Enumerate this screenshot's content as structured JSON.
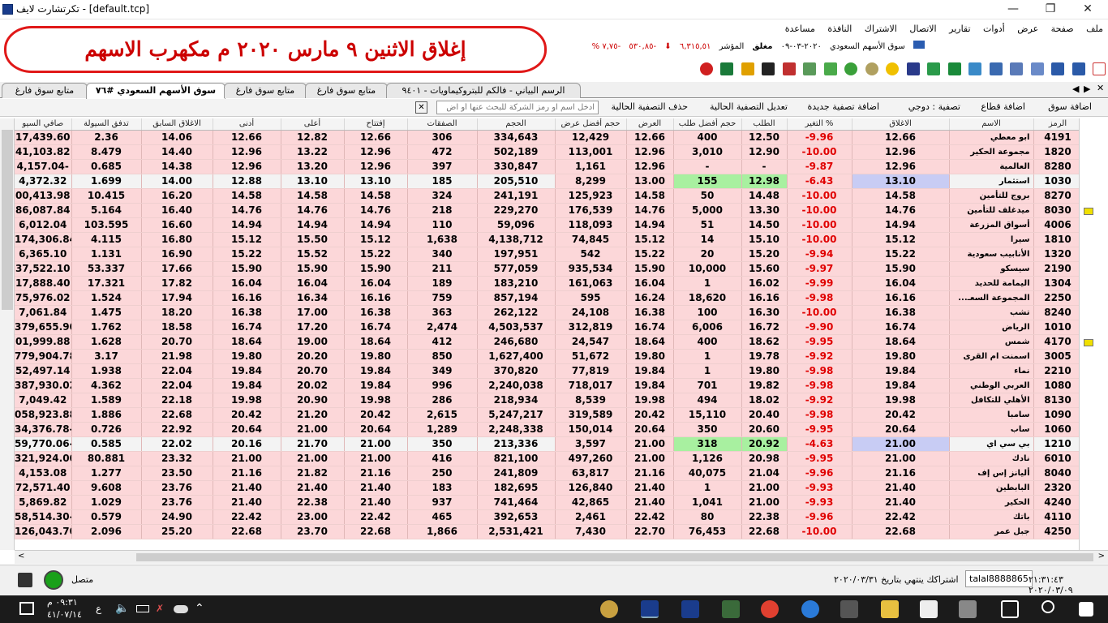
{
  "window": {
    "title": "تكرتشارت لايف - [default.tcp]"
  },
  "menu": [
    "ملف",
    "صفحة",
    "عرض",
    "أدوات",
    "تقارير",
    "الاتصال",
    "الاشتراك",
    "النافذة",
    "مساعدة"
  ],
  "banner": {
    "text": "إغلاق الاثنين ٩ مارس ٢٠٢٠ م  مكهرب الاسهم"
  },
  "ticker": {
    "market": "سوق الأسهم السعودي",
    "date": "٢٠٢٠-٠٣-٠٩",
    "state": "مغلق",
    "index_label": "المؤشر",
    "index_value": "٦,٣١٥,٥١",
    "change": "-٥٣٠,٨٥",
    "pct": "-٧,٧٥ %"
  },
  "tabs": [
    "متابع سوق فارغ",
    "سوق الأسهم السعودي #٧٦",
    "متابع سوق فارغ",
    "متابع سوق فارغ",
    "الرسم البياني - فالكم للبتروكيماويات - ٩٤٠١"
  ],
  "filterbar": {
    "add_market": "اضافة سوق",
    "add_sector": "اضافة قطاع",
    "filter": "تصفية : دوجي",
    "new_filter": "اضافة تصفية جديدة",
    "edit_filter": "تعديل التصفية الحالية",
    "delete_filter": "حذف التصفية الحالية",
    "search_placeholder": "ادخل اسم او رمز الشركة للبحث عنها أو اض"
  },
  "columns": [
    "صافي السيو",
    "تدفق السيولة",
    "الاغلاق السابق",
    "أدنى",
    "أعلى",
    "إفتتاح",
    "الصفقات",
    "الحجم",
    "حجم أفضل عرض",
    "العرض",
    "حجم أفضل طلب",
    "الطلب",
    "التغير %",
    "الاغلاق",
    "الاسم",
    "الرمز"
  ],
  "rows": [
    {
      "code": "4191",
      "name": "ابو معطي",
      "close": "12.66",
      "pct": "-9.96",
      "bid": "12.50",
      "bidsize": "400",
      "ask": "12.66",
      "asksize": "12,429",
      "vol": "334,643",
      "trades": "306",
      "open": "12.66",
      "high": "12.82",
      "low": "12.66",
      "prev": "14.06",
      "flow": "2.36",
      "net": "17,439.60"
    },
    {
      "code": "1820",
      "name": "مجموعة الحكير",
      "close": "12.96",
      "pct": "-10.00",
      "bid": "12.90",
      "bidsize": "3,010",
      "ask": "12.96",
      "asksize": "113,001",
      "vol": "502,189",
      "trades": "472",
      "open": "12.96",
      "high": "13.22",
      "low": "12.96",
      "prev": "14.40",
      "flow": "8.479",
      "net": "41,103.82"
    },
    {
      "code": "8280",
      "name": "العالمية",
      "close": "12.96",
      "pct": "-9.87",
      "bid": "-",
      "bidsize": "-",
      "ask": "12.96",
      "asksize": "1,161",
      "vol": "330,847",
      "trades": "397",
      "open": "12.96",
      "high": "13.20",
      "low": "12.96",
      "prev": "14.38",
      "flow": "0.685",
      "net": "4,157.04-"
    },
    {
      "code": "1030",
      "name": "استثمار",
      "close": "13.10",
      "pct": "-6.43",
      "bid": "12.98",
      "bidsize": "155",
      "ask": "13.00",
      "asksize": "8,299",
      "vol": "205,510",
      "trades": "185",
      "open": "13.10",
      "high": "13.10",
      "low": "12.88",
      "prev": "14.00",
      "flow": "1.699",
      "net": "4,372.32",
      "hl": true
    },
    {
      "code": "8270",
      "name": "بروج للتأمين",
      "close": "14.58",
      "pct": "-10.00",
      "bid": "14.48",
      "bidsize": "50",
      "ask": "14.58",
      "asksize": "125,923",
      "vol": "241,191",
      "trades": "324",
      "open": "14.58",
      "high": "14.58",
      "low": "14.58",
      "prev": "16.20",
      "flow": "10.415",
      "net": "00,413.98"
    },
    {
      "code": "8030",
      "name": "ميدغلف للتأمين",
      "close": "14.76",
      "pct": "-10.00",
      "bid": "13.30",
      "bidsize": "5,000",
      "ask": "14.76",
      "asksize": "176,539",
      "vol": "229,270",
      "trades": "218",
      "open": "14.76",
      "high": "14.76",
      "low": "14.76",
      "prev": "16.40",
      "flow": "5.164",
      "net": "86,087.84",
      "flag": true
    },
    {
      "code": "4006",
      "name": "أسواق المزرعة",
      "close": "14.94",
      "pct": "-10.00",
      "bid": "14.50",
      "bidsize": "51",
      "ask": "14.94",
      "asksize": "118,093",
      "vol": "59,096",
      "trades": "110",
      "open": "14.94",
      "high": "14.94",
      "low": "14.94",
      "prev": "16.60",
      "flow": "103.595",
      "net": "6,012.04"
    },
    {
      "code": "1810",
      "name": "سيرا",
      "close": "15.12",
      "pct": "-10.00",
      "bid": "15.10",
      "bidsize": "14",
      "ask": "15.12",
      "asksize": "74,845",
      "vol": "4,138,712",
      "trades": "1,638",
      "open": "15.12",
      "high": "15.50",
      "low": "15.12",
      "prev": "16.80",
      "flow": "4.115",
      "net": "174,306.84"
    },
    {
      "code": "1320",
      "name": "الأنابيب سعودية",
      "close": "15.22",
      "pct": "-9.94",
      "bid": "15.20",
      "bidsize": "20",
      "ask": "15.22",
      "asksize": "542",
      "vol": "197,951",
      "trades": "340",
      "open": "15.22",
      "high": "15.52",
      "low": "15.22",
      "prev": "16.90",
      "flow": "1.131",
      "net": "6,365.10"
    },
    {
      "code": "2190",
      "name": "سيسكو",
      "close": "15.90",
      "pct": "-9.97",
      "bid": "15.60",
      "bidsize": "10,000",
      "ask": "15.90",
      "asksize": "935,534",
      "vol": "577,059",
      "trades": "211",
      "open": "15.90",
      "high": "15.90",
      "low": "15.90",
      "prev": "17.66",
      "flow": "53.337",
      "net": "37,522.10"
    },
    {
      "code": "1304",
      "name": "اليمامة للحديد",
      "close": "16.04",
      "pct": "-9.99",
      "bid": "16.02",
      "bidsize": "1",
      "ask": "16.04",
      "asksize": "161,063",
      "vol": "183,210",
      "trades": "189",
      "open": "16.04",
      "high": "16.04",
      "low": "16.04",
      "prev": "17.82",
      "flow": "17.321",
      "net": "17,888.40"
    },
    {
      "code": "2250",
      "name": "المجموعة السعـ...",
      "close": "16.16",
      "pct": "-9.98",
      "bid": "16.16",
      "bidsize": "18,620",
      "ask": "16.24",
      "asksize": "595",
      "vol": "857,194",
      "trades": "759",
      "open": "16.16",
      "high": "16.34",
      "low": "16.16",
      "prev": "17.94",
      "flow": "1.524",
      "net": "75,976.02"
    },
    {
      "code": "8240",
      "name": "تشب",
      "close": "16.38",
      "pct": "-10.00",
      "bid": "16.30",
      "bidsize": "100",
      "ask": "16.38",
      "asksize": "24,108",
      "vol": "262,122",
      "trades": "363",
      "open": "16.38",
      "high": "17.00",
      "low": "16.38",
      "prev": "18.20",
      "flow": "1.475",
      "net": "7,061.84"
    },
    {
      "code": "1010",
      "name": "الرياض",
      "close": "16.74",
      "pct": "-9.90",
      "bid": "16.72",
      "bidsize": "6,006",
      "ask": "16.74",
      "asksize": "312,819",
      "vol": "4,503,537",
      "trades": "2,474",
      "open": "16.74",
      "high": "17.20",
      "low": "16.74",
      "prev": "18.58",
      "flow": "1.762",
      "net": "379,655.90"
    },
    {
      "code": "4170",
      "name": "شمس",
      "close": "18.64",
      "pct": "-9.95",
      "bid": "18.62",
      "bidsize": "400",
      "ask": "18.64",
      "asksize": "24,547",
      "vol": "246,680",
      "trades": "412",
      "open": "18.64",
      "high": "19.00",
      "low": "18.64",
      "prev": "20.70",
      "flow": "1.628",
      "net": "01,999.88",
      "flag": true
    },
    {
      "code": "3005",
      "name": "اسمنت ام القرى",
      "close": "19.80",
      "pct": "-9.92",
      "bid": "19.78",
      "bidsize": "1",
      "ask": "19.80",
      "asksize": "51,672",
      "vol": "1,627,400",
      "trades": "850",
      "open": "19.80",
      "high": "20.20",
      "low": "19.80",
      "prev": "21.98",
      "flow": "3.17",
      "net": "779,904.78"
    },
    {
      "code": "2210",
      "name": "نماء",
      "close": "19.84",
      "pct": "-9.98",
      "bid": "19.80",
      "bidsize": "1",
      "ask": "19.84",
      "asksize": "77,819",
      "vol": "370,820",
      "trades": "349",
      "open": "19.84",
      "high": "20.70",
      "low": "19.84",
      "prev": "22.04",
      "flow": "1.938",
      "net": "52,497.14"
    },
    {
      "code": "1080",
      "name": "العربي الوطني",
      "close": "19.84",
      "pct": "-9.98",
      "bid": "19.82",
      "bidsize": "701",
      "ask": "19.84",
      "asksize": "718,017",
      "vol": "2,240,038",
      "trades": "996",
      "open": "19.84",
      "high": "20.02",
      "low": "19.84",
      "prev": "22.04",
      "flow": "4.362",
      "net": "387,930.02"
    },
    {
      "code": "8130",
      "name": "الأهلي للتكافل",
      "close": "19.98",
      "pct": "-9.92",
      "bid": "18.02",
      "bidsize": "494",
      "ask": "19.98",
      "asksize": "8,539",
      "vol": "218,934",
      "trades": "286",
      "open": "19.98",
      "high": "20.90",
      "low": "19.98",
      "prev": "22.18",
      "flow": "1.589",
      "net": "7,049.42"
    },
    {
      "code": "1090",
      "name": "سامبا",
      "close": "20.42",
      "pct": "-9.98",
      "bid": "20.40",
      "bidsize": "15,110",
      "ask": "20.42",
      "asksize": "319,589",
      "vol": "5,247,217",
      "trades": "2,615",
      "open": "20.42",
      "high": "21.20",
      "low": "20.42",
      "prev": "22.68",
      "flow": "1.886",
      "net": "058,923.88"
    },
    {
      "code": "1060",
      "name": "ساب",
      "close": "20.64",
      "pct": "-9.95",
      "bid": "20.60",
      "bidsize": "350",
      "ask": "20.64",
      "asksize": "150,014",
      "vol": "2,248,338",
      "trades": "1,289",
      "open": "20.64",
      "high": "21.00",
      "low": "20.64",
      "prev": "22.92",
      "flow": "0.726",
      "net": "34,376.78-"
    },
    {
      "code": "1210",
      "name": "بي سي اي",
      "close": "21.00",
      "pct": "-4.63",
      "bid": "20.92",
      "bidsize": "318",
      "ask": "21.00",
      "asksize": "3,597",
      "vol": "213,336",
      "trades": "350",
      "open": "21.00",
      "high": "21.70",
      "low": "20.16",
      "prev": "22.02",
      "flow": "0.585",
      "net": "59,770.06-",
      "hl": true
    },
    {
      "code": "6010",
      "name": "نادك",
      "close": "21.00",
      "pct": "-9.95",
      "bid": "20.98",
      "bidsize": "1,126",
      "ask": "21.00",
      "asksize": "497,260",
      "vol": "821,100",
      "trades": "416",
      "open": "21.00",
      "high": "21.00",
      "low": "21.00",
      "prev": "23.32",
      "flow": "80.881",
      "net": "321,924.00"
    },
    {
      "code": "8040",
      "name": "أليانز إس إف",
      "close": "21.16",
      "pct": "-9.96",
      "bid": "21.04",
      "bidsize": "40,075",
      "ask": "21.16",
      "asksize": "63,817",
      "vol": "241,809",
      "trades": "250",
      "open": "21.16",
      "high": "21.82",
      "low": "21.16",
      "prev": "23.50",
      "flow": "1.277",
      "net": "4,153.08"
    },
    {
      "code": "2320",
      "name": "البابطين",
      "close": "21.40",
      "pct": "-9.93",
      "bid": "21.00",
      "bidsize": "1",
      "ask": "21.40",
      "asksize": "126,840",
      "vol": "182,695",
      "trades": "183",
      "open": "21.40",
      "high": "21.40",
      "low": "21.40",
      "prev": "23.76",
      "flow": "9.608",
      "net": "72,571.40"
    },
    {
      "code": "4240",
      "name": "الحكير",
      "close": "21.40",
      "pct": "-9.93",
      "bid": "21.00",
      "bidsize": "1,041",
      "ask": "21.40",
      "asksize": "42,865",
      "vol": "741,464",
      "trades": "937",
      "open": "21.40",
      "high": "22.38",
      "low": "21.40",
      "prev": "23.76",
      "flow": "1.029",
      "net": "5,869.82"
    },
    {
      "code": "4110",
      "name": "باتك",
      "close": "22.42",
      "pct": "-9.96",
      "bid": "22.38",
      "bidsize": "80",
      "ask": "22.42",
      "asksize": "2,461",
      "vol": "392,653",
      "trades": "465",
      "open": "22.42",
      "high": "23.00",
      "low": "22.42",
      "prev": "24.90",
      "flow": "0.579",
      "net": "58,514.30-"
    },
    {
      "code": "4250",
      "name": "جبل عمر",
      "close": "22.68",
      "pct": "-10.00",
      "bid": "22.68",
      "bidsize": "76,453",
      "ask": "22.70",
      "asksize": "7,430",
      "vol": "2,531,421",
      "trades": "1,866",
      "open": "22.68",
      "high": "23.70",
      "low": "22.68",
      "prev": "25.20",
      "flow": "2.096",
      "net": "126,043.70"
    }
  ],
  "status": {
    "connected": "متصل",
    "subscription": "اشتراكك ينتهي بتاريخ ٢٠٢٠/٠٣/٣١",
    "user": "talal8888865",
    "time": "٢١:٣١:٤٣ ٢٠٢٠/٠٣/٠٩"
  },
  "taskbar": {
    "time": "٠٩:٣١ م",
    "date": "٤١/٠٧/١٤",
    "lang": "ع"
  }
}
